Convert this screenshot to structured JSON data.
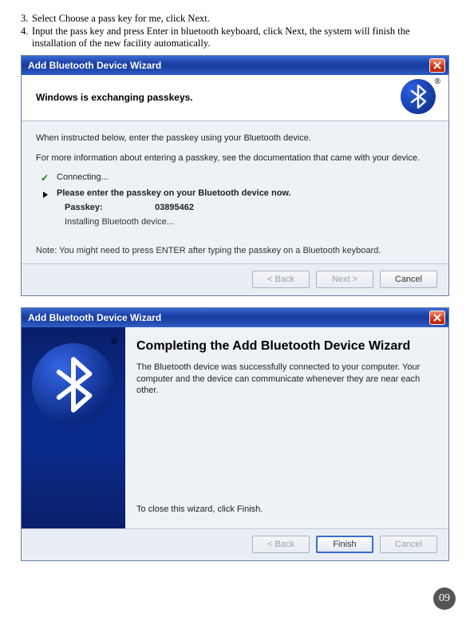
{
  "instructions": {
    "item3_num": "3.",
    "item3_text": "Select Choose a pass key for me, click Next.",
    "item4_num": "4.",
    "item4_text": "Input the pass key and press Enter in bluetooth keyboard, click Next, the system will finish the installation of the new facility automatically."
  },
  "wizard1": {
    "title": "Add Bluetooth Device Wizard",
    "header_text": "Windows is exchanging passkeys.",
    "intro1": "When instructed below, enter the passkey using your Bluetooth device.",
    "intro2": "For more information about entering a passkey, see the documentation that came with your device.",
    "step_connecting": "Connecting...",
    "step_enter": "Please enter the passkey on your Bluetooth device now.",
    "passkey_label": "Passkey:",
    "passkey_value": "03895462",
    "installing": "Installing Bluetooth device...",
    "note": "Note: You might need to press ENTER after typing the passkey on a Bluetooth keyboard.",
    "buttons": {
      "back": "< Back",
      "next": "Next >",
      "cancel": "Cancel"
    }
  },
  "wizard2": {
    "title": "Add Bluetooth Device Wizard",
    "heading": "Completing the Add Bluetooth Device Wizard",
    "body": "The Bluetooth device was successfully connected to your computer. Your computer and the device can communicate whenever they are near each other.",
    "to_close": "To close this wizard, click Finish.",
    "buttons": {
      "back": "< Back",
      "finish": "Finish",
      "cancel": "Cancel"
    }
  },
  "icons": {
    "bluetooth": "bluetooth-icon",
    "close": "close-icon",
    "registered": "®"
  },
  "page_number": "09"
}
